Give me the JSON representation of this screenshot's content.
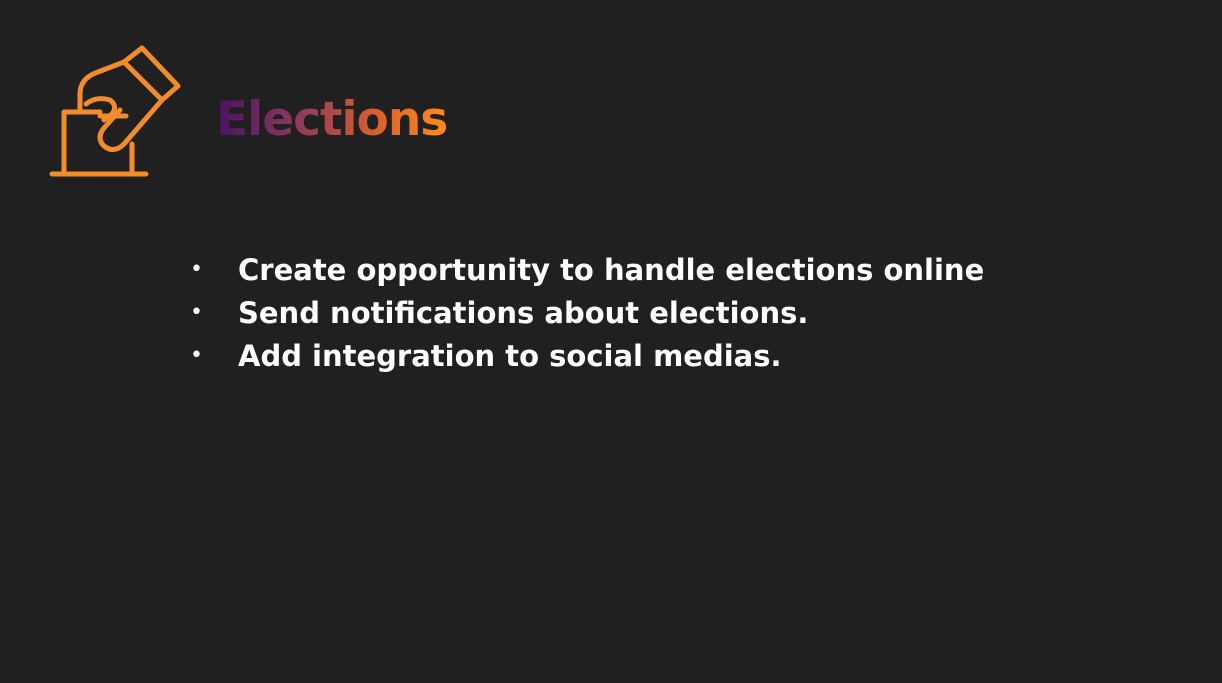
{
  "slide": {
    "title": "Elections",
    "bullets": [
      "Create opportunity to handle elections online",
      "Send notifications about elections.",
      "Add integration to social medias."
    ],
    "bullet_marker": "•"
  },
  "colors": {
    "background": "#202020",
    "icon_orange": "#f28b2c",
    "text": "#ffffff",
    "title_gradient": [
      "#4a1262",
      "#8b3a5c",
      "#d9602e",
      "#ff8c1a"
    ]
  },
  "icons": {
    "ballot": "ballot-box-hand-icon"
  }
}
